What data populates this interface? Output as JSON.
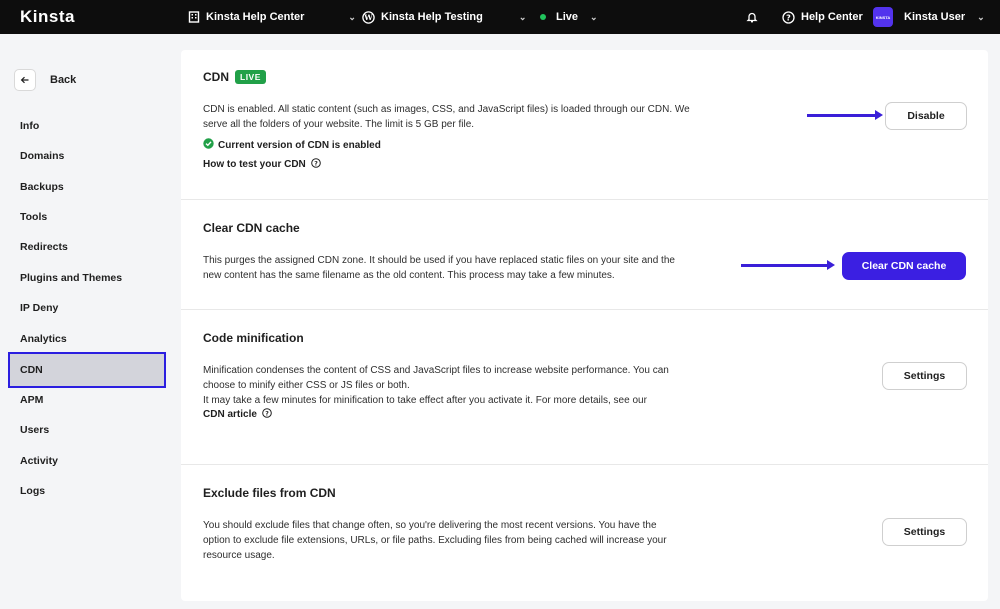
{
  "topbar": {
    "logo": "Kinsta",
    "company": "Kinsta Help Center",
    "site": "Kinsta Help Testing",
    "environment": "Live",
    "help": "Help Center",
    "user": "Kinsta User",
    "avatar_text": "KINSTA"
  },
  "sidebar": {
    "back_label": "Back",
    "items": [
      {
        "label": "Info"
      },
      {
        "label": "Domains"
      },
      {
        "label": "Backups"
      },
      {
        "label": "Tools"
      },
      {
        "label": "Redirects"
      },
      {
        "label": "Plugins and Themes"
      },
      {
        "label": "IP Deny"
      },
      {
        "label": "Analytics"
      },
      {
        "label": "CDN",
        "active": true
      },
      {
        "label": "APM"
      },
      {
        "label": "Users"
      },
      {
        "label": "Activity"
      },
      {
        "label": "Logs"
      }
    ]
  },
  "sections": {
    "cdn": {
      "title": "CDN",
      "badge": "LIVE",
      "desc_line1": "CDN is enabled. All static content (such as images, CSS, and JavaScript files) is loaded through our CDN. We",
      "desc_line2": "serve all the folders of your website. The limit is 5 GB per file.",
      "status": "Current version of CDN is enabled",
      "link": "How to test your CDN",
      "button": "Disable"
    },
    "clear_cache": {
      "title": "Clear CDN cache",
      "desc_line1": "This purges the assigned CDN zone. It should be used if you have replaced static files on your site and the",
      "desc_line2": "new content has the same filename as the old content. This process may take a few minutes.",
      "button": "Clear CDN cache"
    },
    "minification": {
      "title": "Code minification",
      "desc_line1": "Minification condenses the content of CSS and JavaScript files to increase website performance. You can",
      "desc_line2": "choose to minify either CSS or JS files or both.",
      "desc_line3": "It may take a few minutes for minification to take effect after you activate it. For more details, see our",
      "link": "CDN article",
      "button": "Settings"
    },
    "exclude": {
      "title": "Exclude files from CDN",
      "desc_line1": "You should exclude files that change often, so you're delivering the most recent versions. You have the",
      "desc_line2": "option to exclude file extensions, URLs, or file paths. Excluding files from being cached will increase your",
      "desc_line3": "resource usage.",
      "button": "Settings"
    }
  },
  "colors": {
    "accent": "#3b1fe2",
    "live_green": "#21a048",
    "topbar_bg": "#0d0d0d"
  }
}
